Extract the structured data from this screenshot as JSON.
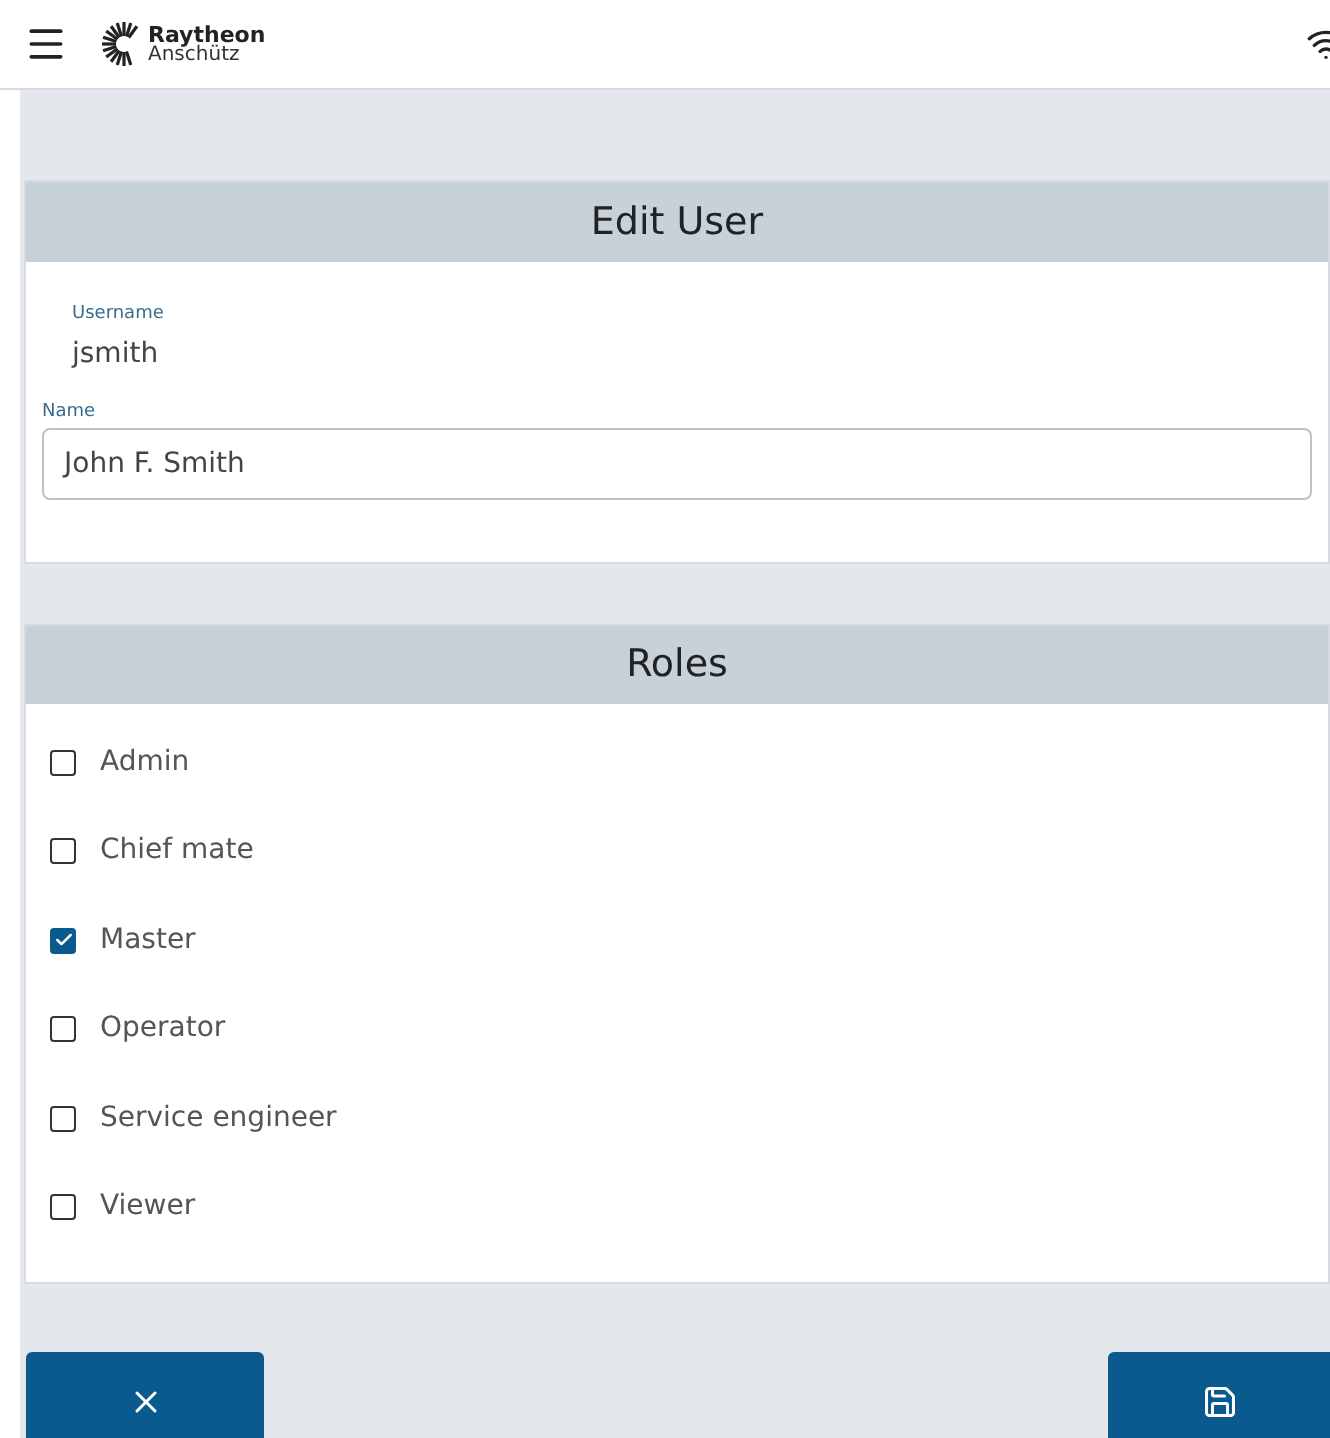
{
  "header": {
    "brand": "Raytheon",
    "sub_brand": "Anschütz"
  },
  "edit_user": {
    "title": "Edit User",
    "username_label": "Username",
    "username": "jsmith",
    "name_label": "Name",
    "name_value": "John F. Smith"
  },
  "roles": {
    "title": "Roles",
    "items": [
      {
        "label": "Admin",
        "checked": false
      },
      {
        "label": "Chief mate",
        "checked": false
      },
      {
        "label": "Master",
        "checked": true
      },
      {
        "label": "Operator",
        "checked": false
      },
      {
        "label": "Service engineer",
        "checked": false
      },
      {
        "label": "Viewer",
        "checked": false
      }
    ]
  }
}
